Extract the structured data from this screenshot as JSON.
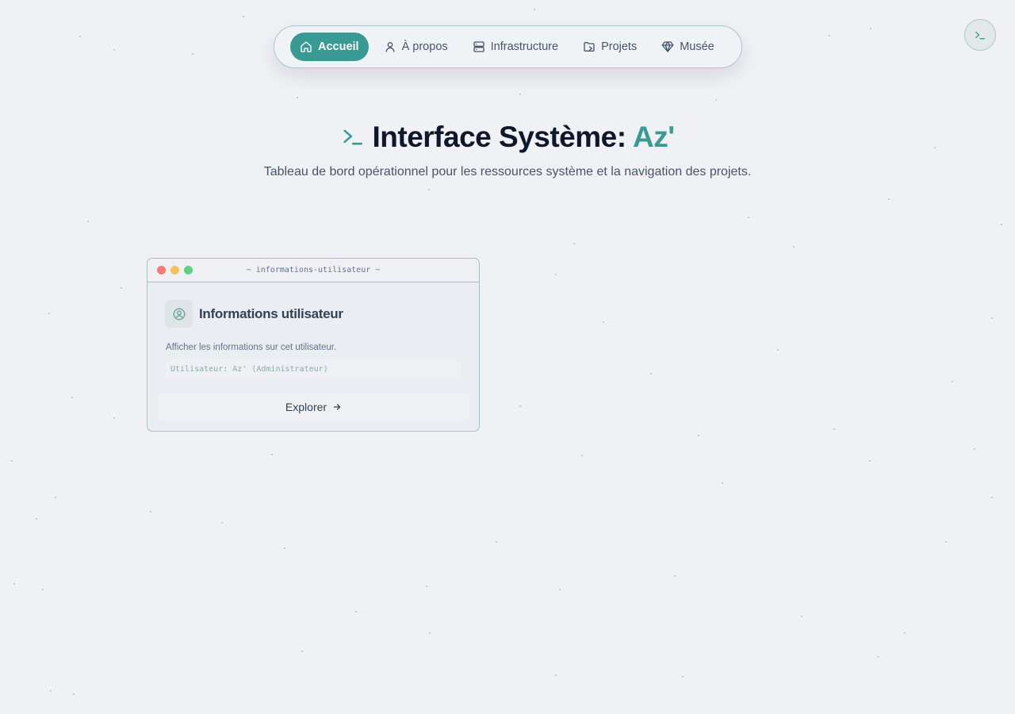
{
  "nav": {
    "items": [
      {
        "label": "Accueil",
        "icon": "home-icon",
        "active": true
      },
      {
        "label": "À propos",
        "icon": "user-icon",
        "active": false
      },
      {
        "label": "Infrastructure",
        "icon": "server-icon",
        "active": false
      },
      {
        "label": "Projets",
        "icon": "folder-icon",
        "active": false
      },
      {
        "label": "Musée",
        "icon": "gem-icon",
        "active": false
      }
    ]
  },
  "terminal_button": {
    "icon": "terminal-icon"
  },
  "hero": {
    "title_main": "Interface Système:",
    "title_accent": "Az'",
    "icon": "terminal-icon",
    "subtitle": "Tableau de bord opérationnel pour les ressources système et la navigation des projets."
  },
  "card": {
    "window_title": "~ informations-utilisateur ~",
    "icon": "user-circle-icon",
    "title": "Informations utilisateur",
    "description": "Afficher les informations sur cet utilisateur.",
    "field_value": "Utilisateur: Az' (Administrateur)",
    "button_label": "Explorer",
    "button_icon": "arrow-right-icon"
  },
  "colors": {
    "accent": "#389a92",
    "background": "#eff1f5",
    "traffic_red": "#f47a79",
    "traffic_yellow": "#f3c15a",
    "traffic_green": "#5fd187"
  }
}
